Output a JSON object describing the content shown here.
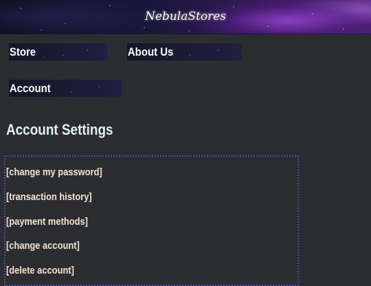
{
  "header": {
    "logo_text": "NebulaStores"
  },
  "nav": {
    "store_label": "Store",
    "about_label": "About Us",
    "account_label": "Account"
  },
  "main": {
    "title": "Account Settings",
    "links": [
      "[change my password]",
      "[transaction history]",
      "[payment methods]",
      "[change account]",
      "[delete account]"
    ]
  },
  "colors": {
    "background": "#2c2d31",
    "title_text": "#dff1f6",
    "link_text": "#f3e3d0",
    "box_border": "#4a4fb0"
  }
}
